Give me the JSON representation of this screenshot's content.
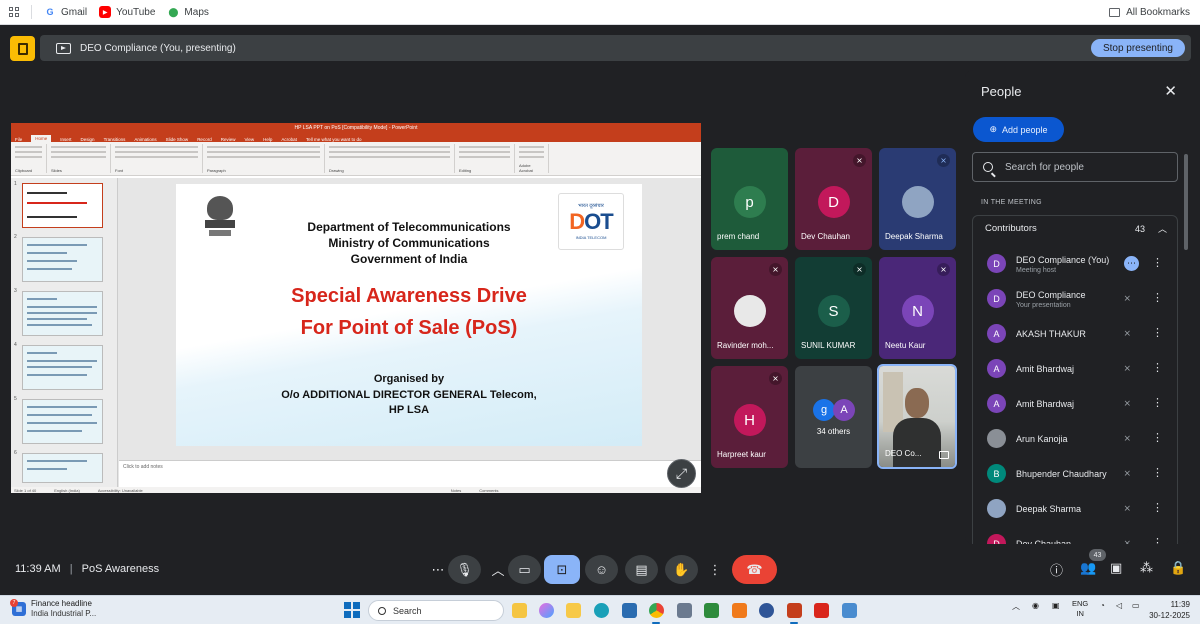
{
  "bookmarks": {
    "items": [
      {
        "label": "Gmail",
        "icon": "gmail-icon"
      },
      {
        "label": "YouTube",
        "icon": "youtube-icon"
      },
      {
        "label": "Maps",
        "icon": "maps-icon"
      }
    ],
    "all_label": "All Bookmarks"
  },
  "presenting": {
    "title": "DEO Compliance (You, presenting)",
    "stop_label": "Stop presenting",
    "accent": "#8ab4f8"
  },
  "ppt": {
    "window_title": "HP LSA PPT on PoS [Compatibility Mode] - PowerPoint",
    "tabs": [
      "File",
      "Home",
      "Insert",
      "Design",
      "Transitions",
      "Animations",
      "Slide Show",
      "Record",
      "Review",
      "View",
      "Help",
      "Acrobat"
    ],
    "tell_me": "Tell me what you want to do",
    "ribbon_groups": [
      "Clipboard",
      "Slides",
      "Font",
      "Paragraph",
      "Drawing",
      "Editing",
      "Adobe Acrobat"
    ],
    "notes_placeholder": "Click to add notes",
    "status_left": "Slide 1 of 40",
    "status_lang": "English (India)",
    "status_access": "Accessibility: Unavailable",
    "status_notes": "Notes",
    "status_comments": "Comments",
    "thumb_numbers": [
      "1",
      "2",
      "3",
      "4",
      "5",
      "6"
    ]
  },
  "slide": {
    "line1": "Department of Telecommunications",
    "line2": "Ministry of Communications",
    "line3": "Government of India",
    "red1": "Special Awareness Drive",
    "red2": "For  Point of Sale (PoS)",
    "org1": "Organised by",
    "org2": "O/o ADDITIONAL DIRECTOR GENERAL Telecom,",
    "org3": "HP LSA",
    "logo_hindi": "भारत दूरसंचार",
    "logo_word_a": "D",
    "logo_word_b": "OT",
    "logo_tag": "INDIA TELECOM"
  },
  "tiles": [
    {
      "name": "prem chand",
      "initial": "p",
      "bg": "#1e5b3a",
      "avbg": "#2e7d4f",
      "mic": false
    },
    {
      "name": "Dev Chauhan",
      "initial": "D",
      "bg": "#5b1e3a",
      "avbg": "#c2185b",
      "mic": true
    },
    {
      "name": "Deepak Sharma",
      "initial": "",
      "bg": "#2a3b73",
      "avbg": "#8fa4c2",
      "mic": true
    },
    {
      "name": "Ravinder moh...",
      "initial": "",
      "bg": "#5b1e3a",
      "avbg": "#e8e8e8",
      "mic": true
    },
    {
      "name": "SUNIL KUMAR",
      "initial": "S",
      "bg": "#123d34",
      "avbg": "#1b5e4a",
      "mic": true
    },
    {
      "name": "Neetu Kaur",
      "initial": "N",
      "bg": "#4a2778",
      "avbg": "#7b45b8",
      "mic": true
    },
    {
      "name": "Harpreet kaur",
      "initial": "H",
      "bg": "#5b1e3a",
      "avbg": "#c2185b",
      "mic": true
    },
    {
      "name": "34 others",
      "initial": "",
      "bg": "#3c4043",
      "avbg": "",
      "mic": false
    },
    {
      "name": "DEO Co...",
      "initial": "",
      "bg": "#cfd0cc",
      "avbg": "",
      "mic": false
    }
  ],
  "others_avatars": [
    "g",
    "A"
  ],
  "people": {
    "title": "People",
    "add_label": "Add people",
    "search_placeholder": "Search for people",
    "section_label": "IN THE MEETING",
    "contributors_label": "Contributors",
    "contributors_count": "43",
    "rows": [
      {
        "initial": "D",
        "name": "DEO Compliance (You)",
        "sub": "Meeting host",
        "color": "#7b45b8"
      },
      {
        "initial": "D",
        "name": "DEO Compliance",
        "sub": "Your presentation",
        "color": "#7b45b8"
      },
      {
        "initial": "A",
        "name": "AKASH THAKUR",
        "sub": "",
        "color": "#7b45b8"
      },
      {
        "initial": "A",
        "name": "Amit Bhardwaj",
        "sub": "",
        "color": "#7b45b8"
      },
      {
        "initial": "A",
        "name": "Amit Bhardwaj",
        "sub": "",
        "color": "#7b45b8"
      },
      {
        "initial": "",
        "name": "Arun Kanojia",
        "sub": "",
        "color": "#8a8f96"
      },
      {
        "initial": "B",
        "name": "Bhupender Chaudhary",
        "sub": "",
        "color": "#00897b"
      },
      {
        "initial": "",
        "name": "Deepak Sharma",
        "sub": "",
        "color": "#8fa4c2"
      },
      {
        "initial": "D",
        "name": "Dev Chauhan",
        "sub": "",
        "color": "#c2185b"
      }
    ]
  },
  "meeting": {
    "time": "11:39 AM",
    "name": "PoS Awareness",
    "people_badge": "43"
  },
  "taskbar": {
    "news_title": "Finance headline",
    "news_sub": "India Industrial P...",
    "news_badge": "7",
    "search_label": "Search",
    "lang_top": "ENG",
    "lang_bottom": "IN",
    "clock_time": "11:39",
    "clock_date": "30-12-2025"
  }
}
